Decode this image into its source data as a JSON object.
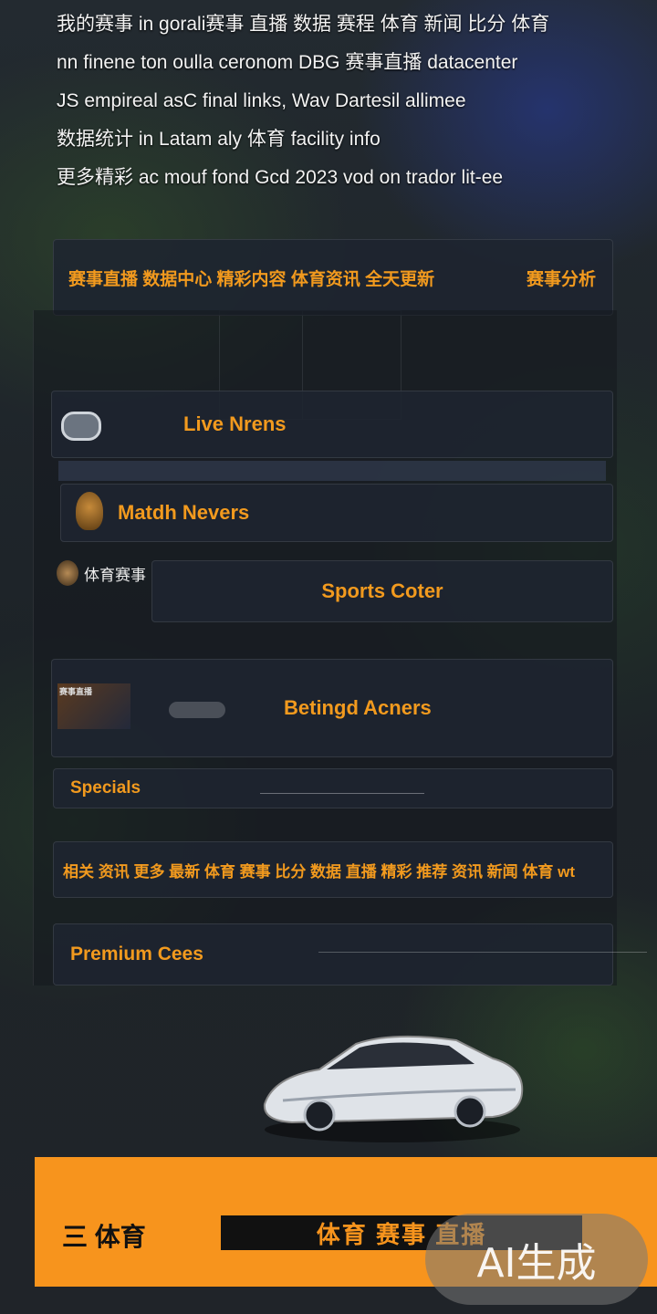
{
  "intro": {
    "lines": [
      "我的赛事 in gorali赛事 直播 数据 赛程 体育 新闻 比分 体育",
      "nn finene ton oulla ceronom DBG 赛事直播 datacenter",
      "JS empireal asC final links, Wav Dartesil allimee",
      "数据统计 in Latam aly 体育 facility info",
      "更多精彩 ac mouf fond Gcd 2023 vod on trador lit-ee"
    ]
  },
  "banner": {
    "text": "赛事直播 数据中心 精彩内容 体育资讯 全天更新",
    "side": "赛事分析"
  },
  "menu": {
    "live_news": "Live Nrens",
    "match_news": "Matdh Nevers",
    "sports_label": "体育赛事",
    "sports_center": "Sports Coter",
    "betting": "Betingd Acners",
    "bet_thumb_caption": "赛事直播",
    "specials": "Specials",
    "notice": "相关 资讯 更多 最新 体育 赛事 比分 数据 直播 精彩 推荐 资讯 新闻 体育 wt",
    "premium": "Premium Cees"
  },
  "cta": {
    "prefix": "三 体育",
    "button": "体育 赛事 直播"
  },
  "watermark": "AI生成",
  "colors": {
    "accent": "#f29a1e",
    "cta_bg": "#f7941d"
  }
}
